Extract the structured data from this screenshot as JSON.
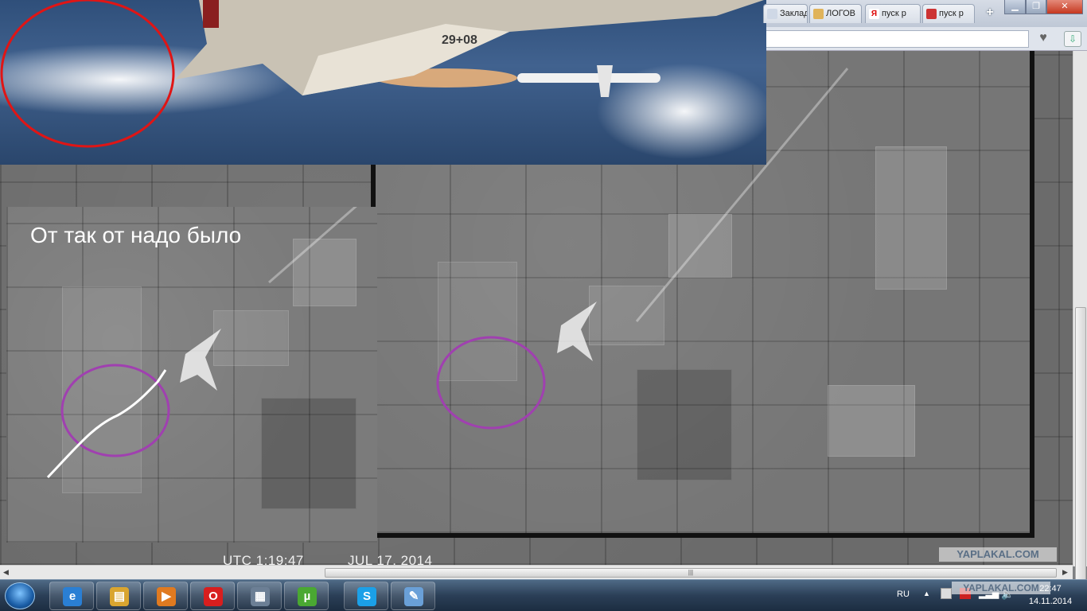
{
  "browser": {
    "tabs": [
      {
        "label": "Заклад",
        "icon": "bookmark-icon"
      },
      {
        "label": "ЛОГОВ",
        "icon": "site-favicon-icon"
      },
      {
        "label": "пуск р",
        "icon": "yandex-icon"
      },
      {
        "label": "пуск р",
        "icon": "image-icon"
      }
    ],
    "new_tab_label": "+",
    "window_buttons": {
      "minimize": "▁",
      "maximize": "❐",
      "close": "✕"
    }
  },
  "image": {
    "caption": "От так от надо было",
    "aircraft_marking": "29+08",
    "utc_label": "UTC  1:19:47",
    "date_label": "JUL 17, 2014"
  },
  "watermarks": {
    "main": "YAPLAKAL.COM",
    "taskbar": "YAPLAKAL.COM"
  },
  "scrollbar": {
    "grip": "|||"
  },
  "taskbar": {
    "apps": [
      {
        "name": "internet-explorer",
        "icon": "ie-icon",
        "glyph": "e",
        "color": "#2a7fd4"
      },
      {
        "name": "file-explorer",
        "icon": "folder-icon",
        "glyph": "▤",
        "color": "#d9a530"
      },
      {
        "name": "media-player",
        "icon": "media-player-icon",
        "glyph": "▶",
        "color": "#e07a20"
      },
      {
        "name": "opera",
        "icon": "opera-icon",
        "glyph": "O",
        "color": "#d81e1e"
      },
      {
        "name": "calculator",
        "icon": "calculator-icon",
        "glyph": "▦",
        "color": "#6c7f95"
      },
      {
        "name": "utorrent",
        "icon": "utorrent-icon",
        "glyph": "µ",
        "color": "#4aa832"
      },
      {
        "name": "skype",
        "icon": "skype-icon",
        "glyph": "S",
        "color": "#1ba0e8"
      },
      {
        "name": "paint",
        "icon": "paint-icon",
        "glyph": "✎",
        "color": "#6aa0d8"
      }
    ],
    "tray": {
      "language": "RU",
      "time": "22:47",
      "date": "14.11.2014"
    }
  }
}
